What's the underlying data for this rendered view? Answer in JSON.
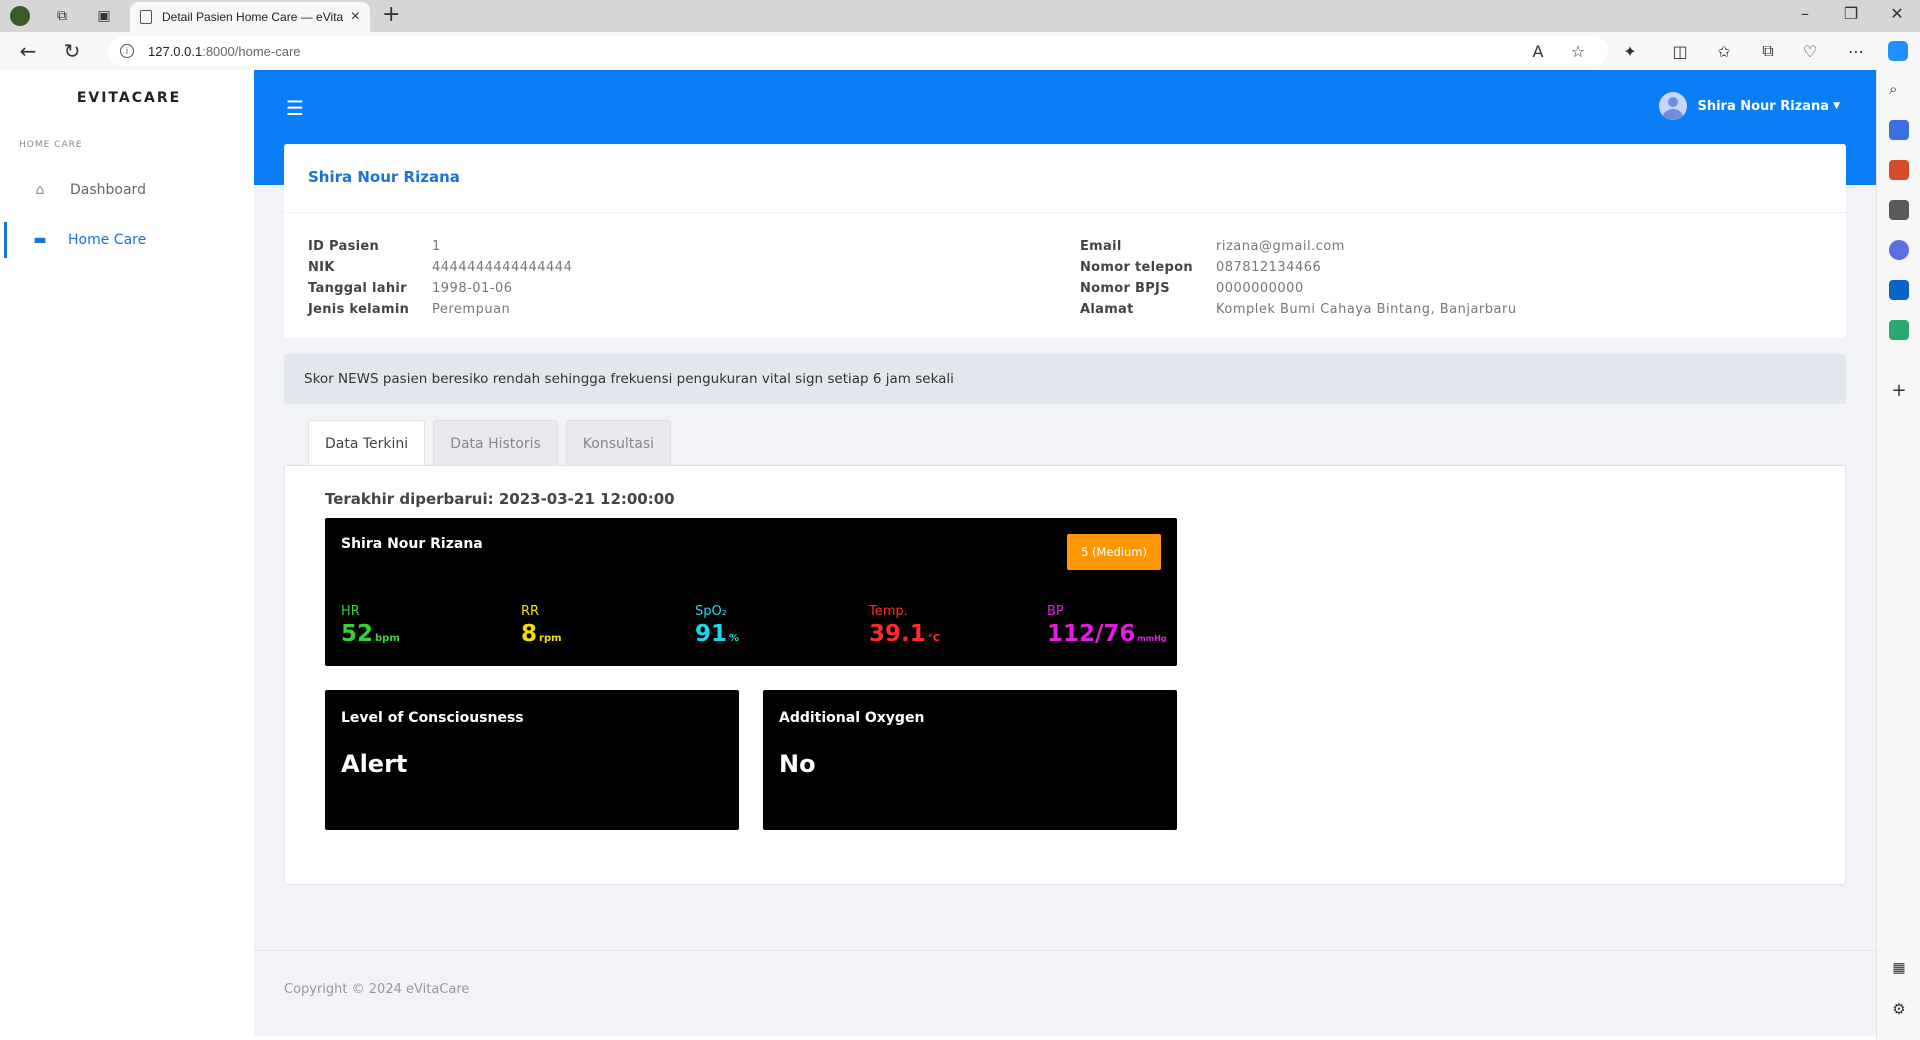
{
  "browser": {
    "tab_title": "Detail Pasien Home Care — eVita",
    "url_host": "127.0.0.1",
    "url_path": ":8000/home-care"
  },
  "sidebar": {
    "brand": "EVITACARE",
    "section": "HOME CARE",
    "items": [
      {
        "label": "Dashboard",
        "icon": "home-icon"
      },
      {
        "label": "Home Care",
        "icon": "bed-icon"
      }
    ]
  },
  "header": {
    "user_name": "Shira Nour Rizana"
  },
  "patient": {
    "name": "Shira Nour Rizana",
    "left_fields": [
      {
        "label": "ID Pasien",
        "value": "1"
      },
      {
        "label": "NIK",
        "value": "4444444444444444"
      },
      {
        "label": "Tanggal lahir",
        "value": "1998-01-06"
      },
      {
        "label": "Jenis kelamin",
        "value": "Perempuan"
      }
    ],
    "right_fields": [
      {
        "label": "Email",
        "value": "rizana@gmail.com"
      },
      {
        "label": "Nomor telepon",
        "value": "087812134466"
      },
      {
        "label": "Nomor BPJS",
        "value": "0000000000"
      },
      {
        "label": "Alamat",
        "value": "Komplek Bumi Cahaya Bintang, Banjarbaru"
      }
    ]
  },
  "alert": "Skor NEWS pasien beresiko rendah sehingga frekuensi pengukuran vital sign setiap 6 jam sekali",
  "tabs": [
    "Data Terkini",
    "Data Historis",
    "Konsultasi"
  ],
  "current": {
    "updated_label": "Terakhir diperbarui: 2023-03-21 12:00:00",
    "monitor_name": "Shira Nour Rizana",
    "news_badge": "5 (Medium)",
    "vitals": [
      {
        "label": "HR",
        "value": "52",
        "unit": "bpm",
        "color": "#35d435"
      },
      {
        "label": "RR",
        "value": "8",
        "unit": "rpm",
        "color": "#f5e000"
      },
      {
        "label": "SpO₂",
        "value": "91",
        "unit": "%",
        "color": "#1ed8e8"
      },
      {
        "label": "Temp.",
        "value": "39.1",
        "unit": "°C",
        "color": "#ff2a2a"
      },
      {
        "label": "BP",
        "value": "112/76",
        "unit": "mmHg",
        "color": "#e01ee0"
      }
    ],
    "consciousness": {
      "title": "Level of Consciousness",
      "value": "Alert"
    },
    "oxygen": {
      "title": "Additional Oxygen",
      "value": "No"
    }
  },
  "footer": "Copyright © 2024 eVitaCare"
}
